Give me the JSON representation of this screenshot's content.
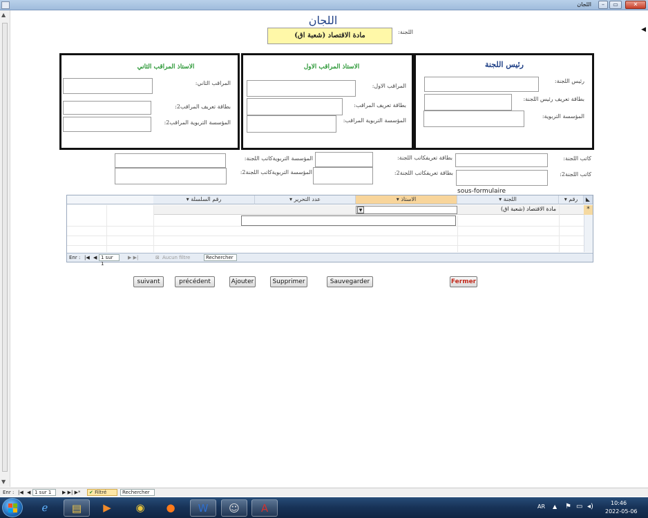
{
  "window": {
    "title": "اللجان"
  },
  "form": {
    "title": "اللجان",
    "committee_label": "اللجنة:",
    "committee_value": "مادة الاقتصاد (شعبة اق)"
  },
  "panels": {
    "president": {
      "title": "رئيس اللجنة",
      "fields": [
        "رئيس اللجنة:",
        "بطاقة تعريف رئيس اللجنة:",
        "المؤسسة التربوية:"
      ]
    },
    "supervisor1": {
      "title": "الاستاذ المراقب الاول",
      "fields": [
        "المراقب الاول:",
        "بطاقة تعريف المراقب:",
        "المؤسسة التربوية المراقب:"
      ]
    },
    "supervisor2": {
      "title": "الاستاذ المراقب الثاني",
      "fields": [
        "المراقب الثاني:",
        "بطاقة تعريف المراقب2:",
        "المؤسسة التربوية المراقب2:"
      ]
    }
  },
  "secretary": {
    "secretary1": "كاتب اللجنة:",
    "id1": "بطاقة تعريفكاتب اللجنة:",
    "inst1": "المؤسسة التربويةكاتب اللجنة:",
    "secretary2": "كاتب اللجنة2:",
    "id2": "بطاقة تعريفكاتب اللجنة2:",
    "inst2": "المؤسسة التربويةكاتب اللجنة2:"
  },
  "subform": {
    "label": "sous-formulaire",
    "columns": [
      "رقم",
      "اللجنة",
      "الاستاذ",
      "عدد التحرير",
      "رقم السلسلة"
    ],
    "row_committee": "مادة الاقتصاد (شعبة اق)",
    "new_row_marker": "*",
    "nav": {
      "record_label": "Enr :",
      "position": "1 sur 1",
      "filter": "Aucun filtre",
      "search": "Rechercher"
    }
  },
  "buttons": {
    "next": "suivant",
    "previous": "précédent",
    "add": "Ajouter",
    "delete": "Supprimer",
    "save": "Sauvegarder",
    "close": "Fermer"
  },
  "main_nav": {
    "record_label": "Enr :",
    "position": "1 sur 1",
    "filter": "Filtré",
    "search": "Rechercher"
  },
  "taskbar": {
    "lang": "AR",
    "time": "10:46",
    "date": "2022-05-06"
  },
  "colors": {
    "panel_title_blue": "#1e3f86",
    "panel_title_green": "#2f9a3a",
    "close_button_text": "#c0281a",
    "committee_field_bg": "#fff8a8"
  }
}
